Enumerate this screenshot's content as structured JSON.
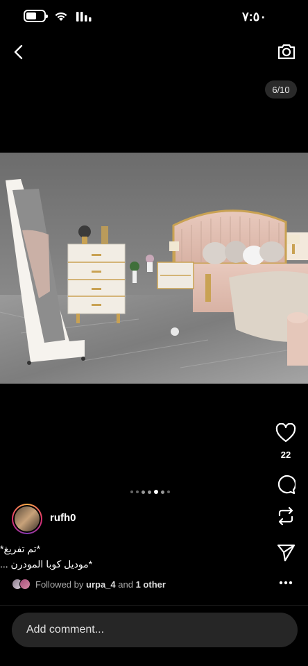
{
  "status": {
    "time": "٧:٥٠"
  },
  "counter": "6/10",
  "like_count": "22",
  "username": "rufh0",
  "caption": {
    "line1": "*تم تفريغ*",
    "line2": "*موديل كوبا المودرن ..."
  },
  "followed": {
    "prefix": "Followed by",
    "user": "urpa_4",
    "and": "and",
    "other": "1 other"
  },
  "comment": {
    "placeholder": "Add comment..."
  },
  "icons": [
    "back-icon",
    "camera-icon",
    "heart-icon",
    "comment-icon",
    "repost-icon",
    "share-icon",
    "more-icon"
  ]
}
